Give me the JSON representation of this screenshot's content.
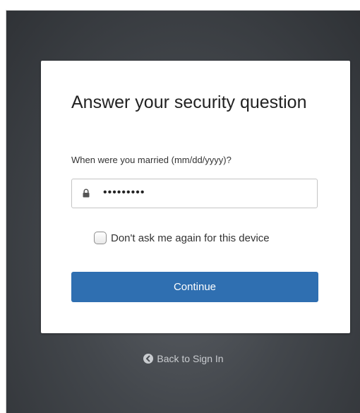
{
  "card": {
    "title": "Answer your security question",
    "question": "When were you married (mm/dd/yyyy)?",
    "answer": {
      "value": "•••••••••",
      "icon": "lock-icon"
    },
    "remember": {
      "label": "Don't ask me again for this device",
      "checked": false
    },
    "continue_label": "Continue"
  },
  "footer": {
    "back_label": "Back to Sign In",
    "back_icon": "left-arrow-circle-icon"
  },
  "colors": {
    "primary": "#2f6fb1",
    "background": "#43474c",
    "card": "#ffffff"
  }
}
